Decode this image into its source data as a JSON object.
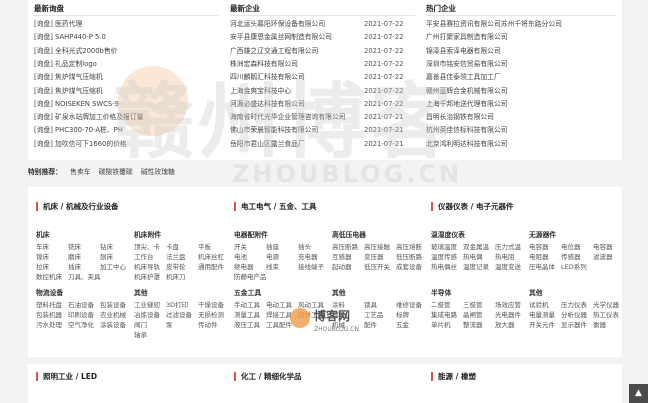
{
  "top": {
    "columns": [
      {
        "title": "最新询盘",
        "items": [
          "[询盘] 医药代理",
          "[询盘] SAHP440-P 5.0",
          "[询盘] 全科光式2000b售价",
          "[询盘] 礼品定制logo",
          "[询盘] 焦炉煤气压缩机",
          "[询盘] 焦炉煤气压缩机",
          "[询盘] NOISEKEN SWCS-9",
          "[询盘] 矿泉水站牌加工价格及报订量",
          "[询盘] PHC300-70-A桩、PH",
          "[询盘] 加吹信可下1660的价格"
        ]
      },
      {
        "title": "最新企业",
        "items": [
          "河北运头慕阳环保设备有限公司",
          "安平县康恩金属丝网制造有限公司",
          "广西雄之辽交通工程有限公司",
          "株洲宏森科技有限公司",
          "四川麟鹅汇科技有限公司",
          "上海金爽宝科技中心",
          "河源必盛达科技有限公司",
          "海南省时代光华企业管理咨询有限公司",
          "佛山市荣晨智能科技有限公司",
          "岳阳市君山区露兰食品厂"
        ]
      },
      {
        "title": "热门企业",
        "items": [
          "平安县赛拉资讯有限公司苏州千将东路分公司",
          "广州打聚家具制造有限公司",
          "锦泽县索泽电器有限公司",
          "深圳市铭安信贸易有限公司",
          "嘉善县佳泰领工具加工厂",
          "赣州蓝辉合金机械有限公司",
          "上海千邦地送代理有限公司",
          "昌明长治钢铁有限公司",
          "杭州英佳信标科技有限公司",
          "北京鸿利明达科技有限公司"
        ]
      }
    ],
    "dates": [
      "2021-07-22",
      "2021-07-22",
      "2021-07-22",
      "2021-07-22",
      "2021-07-22",
      "2021-07-22",
      "2021-07-22",
      "2021-07-21",
      "2021-07-21",
      "2021-07-21"
    ]
  },
  "hot": {
    "label": "特别推荐：",
    "links": [
      "售卖车",
      "碳酸铁覆碳",
      "碱性玫瑰糖"
    ]
  },
  "categories": [
    {
      "title": "机床 / 机械及行业设备",
      "groups": [
        {
          "title": "机床",
          "items": [
            "车床",
            "铣床",
            "钻床",
            "镗床",
            "磨床",
            "刨床",
            "拉床",
            "插床",
            "加工中心",
            "数控机床",
            "刀具、夹具"
          ]
        },
        {
          "title": "机床附件",
          "items": [
            "顶尖、卡",
            "卡盘",
            "平板",
            "工作台",
            "法兰盘",
            "机床丝杠",
            "机床导轨",
            "皮带轮",
            "通用配件",
            "机床护罩",
            "机床刀"
          ]
        },
        {
          "title": "物流设备",
          "items": [
            "塑料托盘",
            "石油设备",
            "包装设备",
            "包装机器",
            "印刷设备",
            "农业机械",
            "污水处理",
            "空气净化",
            "涂装设备"
          ]
        },
        {
          "title": "其他",
          "items": [
            "工业缝纫",
            "3D打印",
            "干燥设备",
            "冶炼设备",
            "过滤设备",
            "无损检测",
            "阀门",
            "泵",
            "传动件",
            "轴承"
          ]
        }
      ]
    },
    {
      "title": "电工电气 / 五金、工具",
      "groups": [
        {
          "title": "电器配附件",
          "items": [
            "开关",
            "插座",
            "插头",
            "电池",
            "电源",
            "充电器",
            "继电器",
            "线束",
            "接线端子",
            "防静电产品"
          ]
        },
        {
          "title": "高低压电器",
          "items": [
            "高压断路",
            "高压接触",
            "高压熔断",
            "互感器",
            "变压器",
            "低压断路",
            "起动器",
            "低压开关",
            "成套设备"
          ]
        },
        {
          "title": "五金工具",
          "items": [
            "手动工具",
            "电动工具",
            "风动工具",
            "测量工具",
            "焊接工具",
            "园林工具",
            "液压工具",
            "工具配件"
          ]
        },
        {
          "title": "其他",
          "items": [
            "涂料",
            "锁具",
            "维修设备",
            "锁具",
            "工艺品",
            "标牌",
            "机械",
            "配件",
            "五金"
          ]
        }
      ]
    },
    {
      "title": "仪器仪表 / 电子元器件",
      "groups": [
        {
          "title": "温湿度仪表",
          "items": [
            "玻璃温度",
            "双金属温",
            "压力式温",
            "温度传感",
            "热电偶",
            "热电阻",
            "热电偶丝",
            "温度记录",
            "温度变送"
          ]
        },
        {
          "title": "无源器件",
          "items": [
            "电容器",
            "电位器",
            "电容器",
            "电阻器",
            "传感器",
            "滤波器",
            "压电晶体",
            "LED系列"
          ]
        },
        {
          "title": "半导体",
          "items": [
            "二极管",
            "三极管",
            "场效应管",
            "集成电路",
            "晶闸管",
            "光电器件",
            "单片机",
            "整流器",
            "放大器"
          ]
        },
        {
          "title": "其他",
          "items": [
            "试验机",
            "压力仪表",
            "光学仪器",
            "电量测量",
            "分析仪器",
            "热工仪表",
            "开关元件",
            "显示器件",
            "衡器"
          ]
        }
      ]
    }
  ],
  "bottom": [
    "照明工业 / LED",
    "化工 / 精细化学品",
    "能源 / 橡塑"
  ],
  "watermark": {
    "big": "赣州博客",
    "sub": "ZHOUBLOG.CN",
    "small": "博客网",
    "small_sub": "ZHOUBLOG.CN"
  },
  "totop": "▲"
}
